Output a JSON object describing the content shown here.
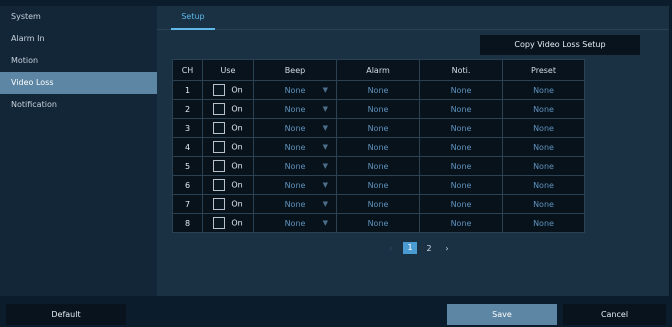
{
  "sidebar": {
    "items": [
      {
        "label": "System",
        "active": false
      },
      {
        "label": "Alarm In",
        "active": false
      },
      {
        "label": "Motion",
        "active": false
      },
      {
        "label": "Video Loss",
        "active": true
      },
      {
        "label": "Notification",
        "active": false
      }
    ]
  },
  "tabs": [
    {
      "label": "Setup",
      "active": true
    }
  ],
  "copy_button": "Copy Video Loss Setup",
  "table": {
    "headers": [
      "CH",
      "Use",
      "Beep",
      "Alarm",
      "Noti.",
      "Preset"
    ],
    "rows": [
      {
        "ch": "1",
        "use": "On",
        "beep": "None",
        "alarm": "None",
        "noti": "None",
        "preset": "None"
      },
      {
        "ch": "2",
        "use": "On",
        "beep": "None",
        "alarm": "None",
        "noti": "None",
        "preset": "None"
      },
      {
        "ch": "3",
        "use": "On",
        "beep": "None",
        "alarm": "None",
        "noti": "None",
        "preset": "None"
      },
      {
        "ch": "4",
        "use": "On",
        "beep": "None",
        "alarm": "None",
        "noti": "None",
        "preset": "None"
      },
      {
        "ch": "5",
        "use": "On",
        "beep": "None",
        "alarm": "None",
        "noti": "None",
        "preset": "None"
      },
      {
        "ch": "6",
        "use": "On",
        "beep": "None",
        "alarm": "None",
        "noti": "None",
        "preset": "None"
      },
      {
        "ch": "7",
        "use": "On",
        "beep": "None",
        "alarm": "None",
        "noti": "None",
        "preset": "None"
      },
      {
        "ch": "8",
        "use": "On",
        "beep": "None",
        "alarm": "None",
        "noti": "None",
        "preset": "None"
      }
    ]
  },
  "pagination": {
    "prev_icon": "chevron-left-icon",
    "pages": [
      "1",
      "2"
    ],
    "current": "1",
    "next_icon": "chevron-right-icon"
  },
  "footer": {
    "default_label": "Default",
    "save_label": "Save",
    "cancel_label": "Cancel"
  },
  "colors": {
    "accent": "#5fb8e8",
    "active_item": "#5c86a4",
    "current_page": "#4a9bd1",
    "value_text": "#5f92bd"
  }
}
